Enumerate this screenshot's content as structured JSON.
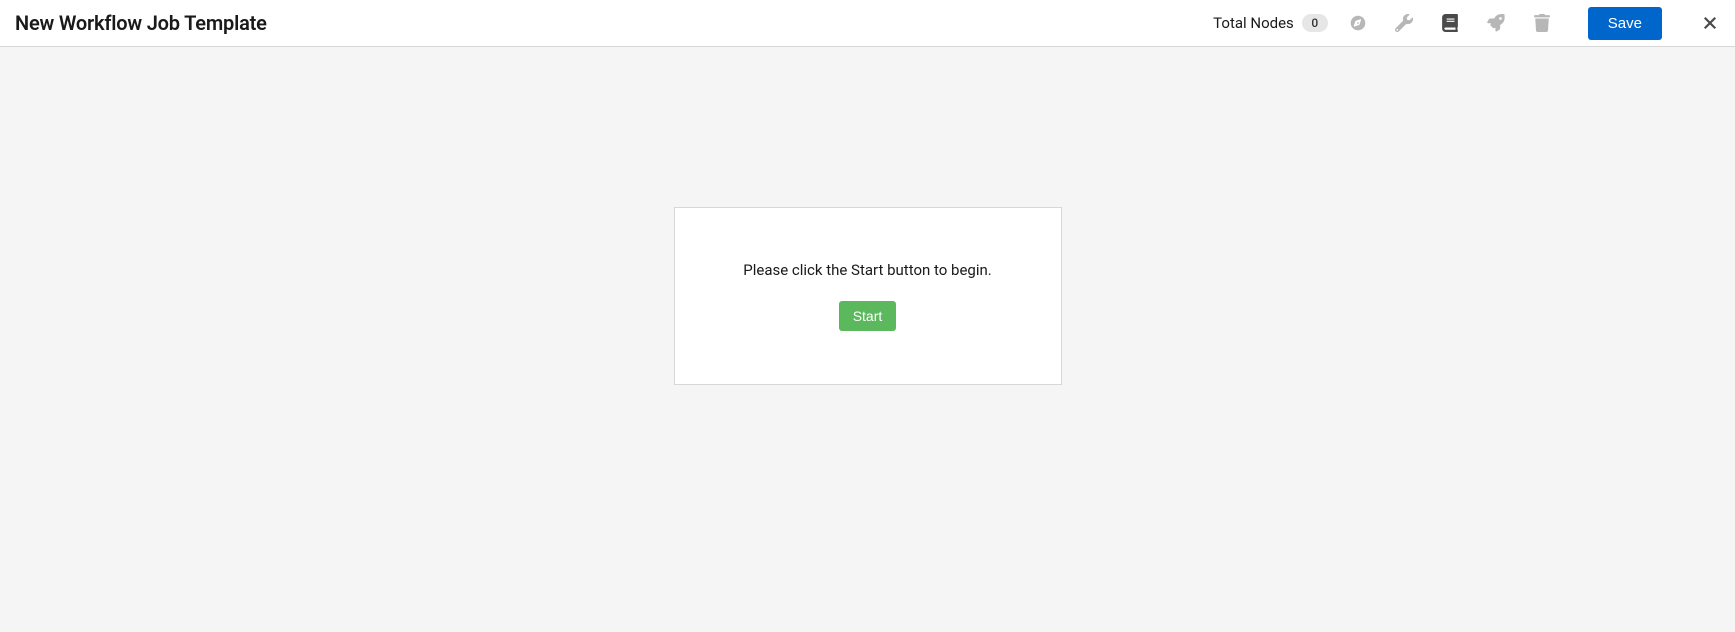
{
  "header": {
    "title": "New Workflow Job Template",
    "total_nodes_label": "Total Nodes",
    "total_nodes_count": "0",
    "save_label": "Save"
  },
  "canvas": {
    "prompt": "Please click the Start button to begin.",
    "start_label": "Start"
  }
}
